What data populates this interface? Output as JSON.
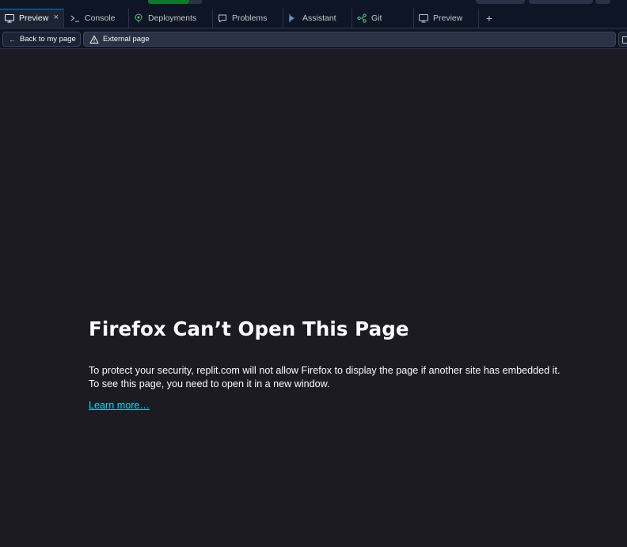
{
  "tabs": [
    {
      "label": "Preview",
      "icon": "monitor-icon",
      "active": true,
      "closable": true
    },
    {
      "label": "Console",
      "icon": "terminal-icon"
    },
    {
      "label": "Deployments",
      "icon": "deployments-icon"
    },
    {
      "label": "Problems",
      "icon": "chat-bubble-icon"
    },
    {
      "label": "Assistant",
      "icon": "assistant-icon"
    },
    {
      "label": "Git",
      "icon": "git-branch-icon"
    },
    {
      "label": "Preview",
      "icon": "monitor-icon"
    }
  ],
  "tab_close_glyph": "×",
  "add_tab_glyph": "+",
  "address_bar": {
    "back_arrow": "←",
    "back_label": "Back to my page",
    "url_label": "External page"
  },
  "error_page": {
    "title": "Firefox Can’t Open This Page",
    "message": "To protect your security, replit.com will not allow Firefox to display the page if another site has embedded it. To see this page, you need to open it in a new window.",
    "link": "Learn more…"
  },
  "colors": {
    "background": "#1c1b22",
    "chrome": "#0e1525",
    "link": "#00ddff",
    "run_button": "#0b7a2c",
    "accent": "#0079f2"
  }
}
